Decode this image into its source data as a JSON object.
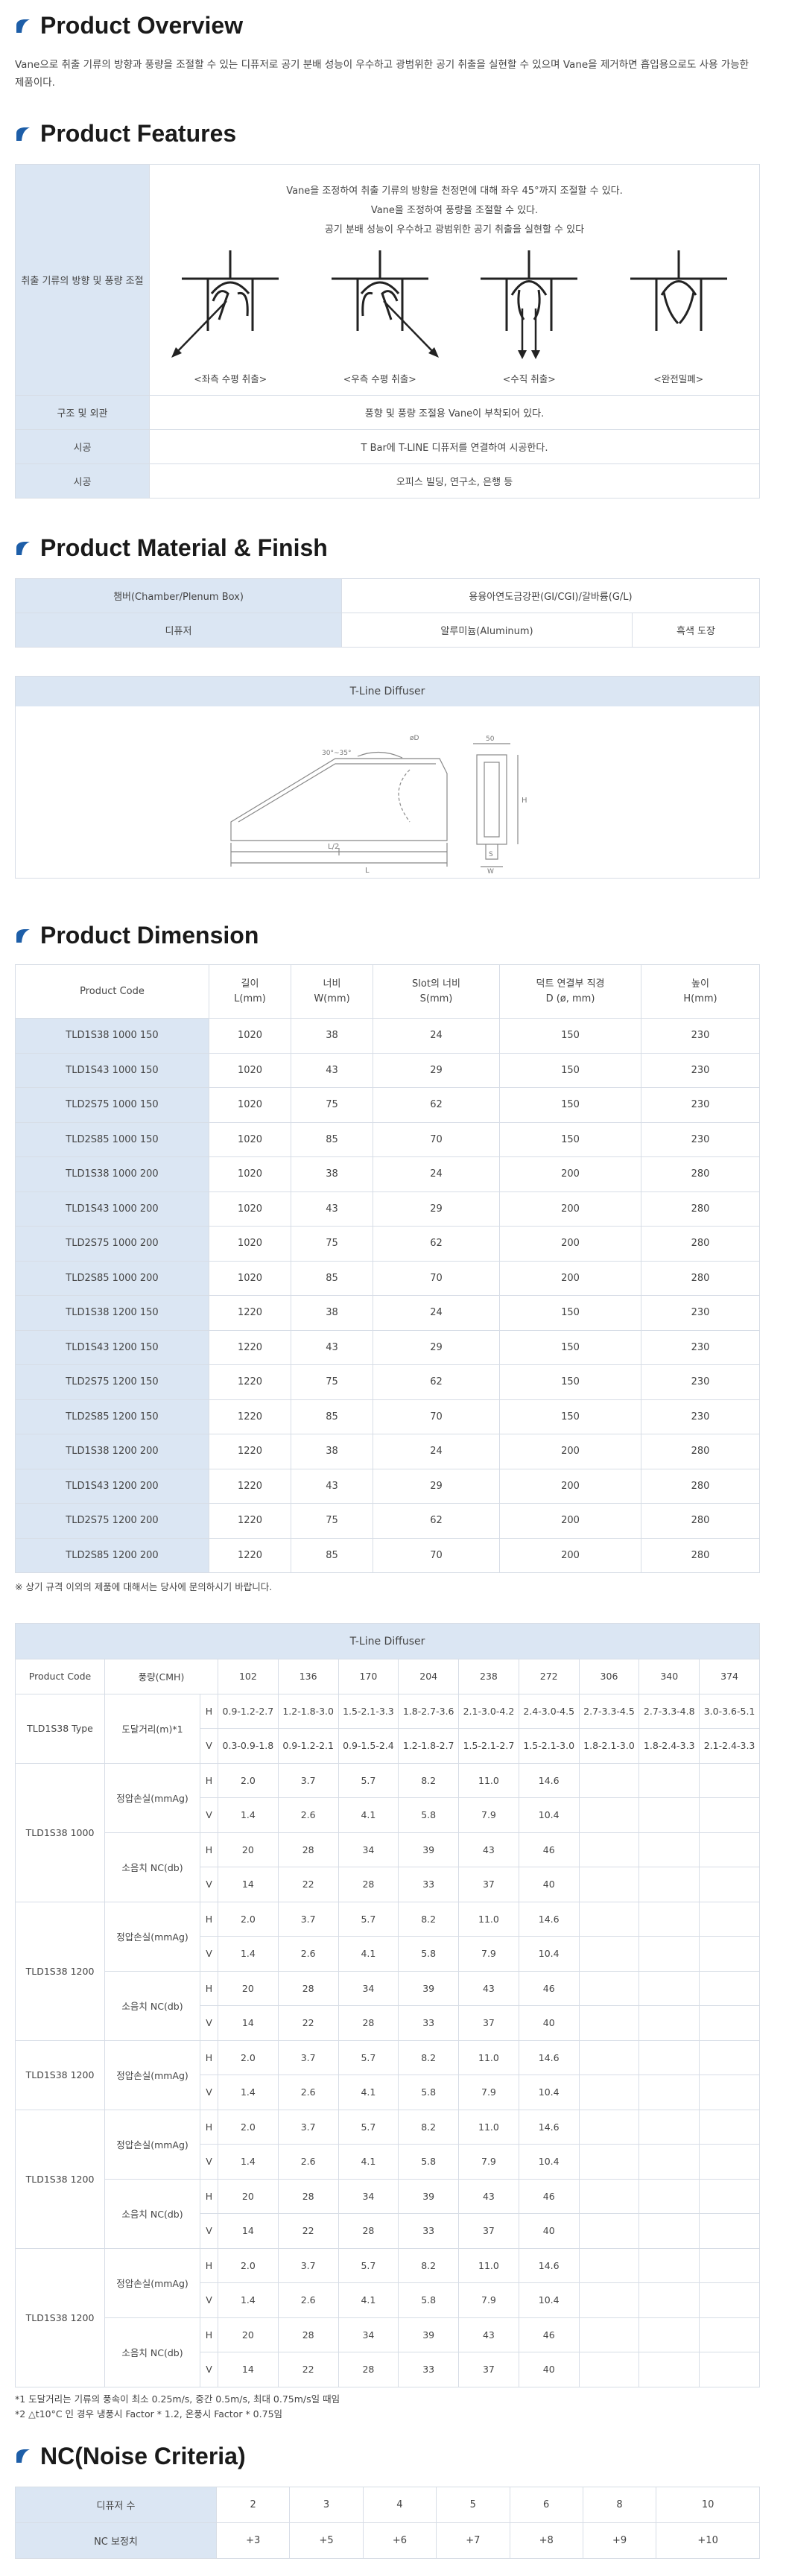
{
  "overview": {
    "title": "Product Overview",
    "text": "Vane으로 취출 기류의 방향과 풍량을 조절할 수 있는 디퓨저로 공기 분배 성능이 우수하고 광범위한 공기 취출을 실현할 수 있으며 Vane을 제거하면 흡입용으로도 사용 가능한 제품이다."
  },
  "features": {
    "title": "Product Features",
    "row1_label": "취출 기류의 방향 및 풍량 조절",
    "lines": [
      "Vane을 조정하여 취출 기류의 방향을 천정면에 대해 좌우 45°까지 조절할 수 있다.",
      "Vane을 조정하여 풍량을 조절할 수 있다.",
      "공기 분배 성능이 우수하고 광범위한 공기 취출을 실현할 수 있다"
    ],
    "captions": [
      "<좌측 수평 취출>",
      "<우측 수평 취출>",
      "<수직 취출>",
      "<완전밀폐>"
    ],
    "rows": [
      {
        "label": "구조 및 외관",
        "value": "풍향 및 풍량 조절용 Vane이 부착되어 있다."
      },
      {
        "label": "시공",
        "value": "T Bar에 T-LINE 디퓨저를 연결하여 시공한다."
      },
      {
        "label": "시공",
        "value": "오피스 빌딩, 연구소, 은행 등"
      }
    ]
  },
  "material": {
    "title": "Product Material & Finish",
    "rows": [
      {
        "label": "챔버(Chamber/Plenum Box)",
        "value": "용융아연도금강판(GI/CGI)/갈바륨(G/L)",
        "finish": ""
      },
      {
        "label": "디퓨저",
        "value": "알루미늄(Aluminum)",
        "finish": "흑색 도장"
      }
    ],
    "diagram_title": "T-Line Diffuser",
    "diagram_labels": {
      "angle": "30°~35°",
      "dia": "øD",
      "l2": "L/2",
      "l": "L",
      "h": "H",
      "s": "S",
      "w": "W",
      "top": "50"
    }
  },
  "dimension": {
    "title": "Product Dimension",
    "headers": [
      "Product Code",
      "길이\nL(mm)",
      "너비\nW(mm)",
      "Slot의 너비\nS(mm)",
      "덕트 연결부 직경\nD (ø, mm)",
      "높이\nH(mm)"
    ],
    "rows": [
      [
        "TLD1S38 1000 150",
        "1020",
        "38",
        "24",
        "150",
        "230"
      ],
      [
        "TLD1S43 1000 150",
        "1020",
        "43",
        "29",
        "150",
        "230"
      ],
      [
        "TLD2S75 1000 150",
        "1020",
        "75",
        "62",
        "150",
        "230"
      ],
      [
        "TLD2S85 1000 150",
        "1020",
        "85",
        "70",
        "150",
        "230"
      ],
      [
        "TLD1S38 1000 200",
        "1020",
        "38",
        "24",
        "200",
        "280"
      ],
      [
        "TLD1S43 1000 200",
        "1020",
        "43",
        "29",
        "200",
        "280"
      ],
      [
        "TLD2S75 1000 200",
        "1020",
        "75",
        "62",
        "200",
        "280"
      ],
      [
        "TLD2S85 1000 200",
        "1020",
        "85",
        "70",
        "200",
        "280"
      ],
      [
        "TLD1S38 1200 150",
        "1220",
        "38",
        "24",
        "150",
        "230"
      ],
      [
        "TLD1S43 1200 150",
        "1220",
        "43",
        "29",
        "150",
        "230"
      ],
      [
        "TLD2S75 1200 150",
        "1220",
        "75",
        "62",
        "150",
        "230"
      ],
      [
        "TLD2S85 1200 150",
        "1220",
        "85",
        "70",
        "150",
        "230"
      ],
      [
        "TLD1S38 1200 200",
        "1220",
        "38",
        "24",
        "200",
        "280"
      ],
      [
        "TLD1S43 1200 200",
        "1220",
        "43",
        "29",
        "200",
        "280"
      ],
      [
        "TLD2S75 1200 200",
        "1220",
        "75",
        "62",
        "200",
        "280"
      ],
      [
        "TLD2S85 1200 200",
        "1220",
        "85",
        "70",
        "200",
        "280"
      ]
    ],
    "note": "※ 상기 규격 이외의 제품에 대해서는 당사에 문의하시기 바랍니다."
  },
  "performance": {
    "title": "T-Line Diffuser",
    "code_label": "Product Code",
    "flow_label": "풍량(CMH)",
    "flows": [
      "102",
      "136",
      "170",
      "204",
      "238",
      "272",
      "306",
      "340",
      "374"
    ],
    "type_label": "TLD1S38 Type",
    "throw_label": "도달거리(m)*1",
    "throw_h": [
      "0.9-1.2-2.7",
      "1.2-1.8-3.0",
      "1.5-2.1-3.3",
      "1.8-2.7-3.6",
      "2.1-3.0-4.2",
      "2.4-3.0-4.5",
      "2.7-3.3-4.5",
      "2.7-3.3-4.8",
      "3.0-3.6-5.1"
    ],
    "throw_v": [
      "0.3-0.9-1.8",
      "0.9-1.2-2.1",
      "0.9-1.5-2.4",
      "1.2-1.8-2.7",
      "1.5-2.1-2.7",
      "1.5-2.1-3.0",
      "1.8-2.1-3.0",
      "1.8-2.4-3.3",
      "2.1-2.4-3.3"
    ],
    "sp_label": "정압손실(mmAg)",
    "nc_label": "소음치 NC(db)",
    "groups": [
      {
        "code": "TLD1S38 1000",
        "sp_h": [
          "2.0",
          "3.7",
          "5.7",
          "8.2",
          "11.0",
          "14.6"
        ],
        "sp_v": [
          "1.4",
          "2.6",
          "4.1",
          "5.8",
          "7.9",
          "10.4"
        ],
        "nc_h": [
          "20",
          "28",
          "34",
          "39",
          "43",
          "46"
        ],
        "nc_v": [
          "14",
          "22",
          "28",
          "33",
          "37",
          "40"
        ]
      },
      {
        "code": "TLD1S38 1200",
        "sp_h": [
          "2.0",
          "3.7",
          "5.7",
          "8.2",
          "11.0",
          "14.6"
        ],
        "sp_v": [
          "1.4",
          "2.6",
          "4.1",
          "5.8",
          "7.9",
          "10.4"
        ],
        "nc_h": [
          "20",
          "28",
          "34",
          "39",
          "43",
          "46"
        ],
        "nc_v": [
          "14",
          "22",
          "28",
          "33",
          "37",
          "40"
        ]
      }
    ],
    "mid_group": {
      "code": "TLD1S38 1200",
      "sp_h": [
        "2.0",
        "3.7",
        "5.7",
        "8.2",
        "11.0",
        "14.6"
      ],
      "sp_v": [
        "1.4",
        "2.6",
        "4.1",
        "5.8",
        "7.9",
        "10.4"
      ]
    },
    "tail_groups": [
      {
        "code": "TLD1S38 1200",
        "sp_h": [
          "2.0",
          "3.7",
          "5.7",
          "8.2",
          "11.0",
          "14.6"
        ],
        "sp_v": [
          "1.4",
          "2.6",
          "4.1",
          "5.8",
          "7.9",
          "10.4"
        ],
        "nc_h": [
          "20",
          "28",
          "34",
          "39",
          "43",
          "46"
        ],
        "nc_v": [
          "14",
          "22",
          "28",
          "33",
          "37",
          "40"
        ]
      },
      {
        "code": "TLD1S38 1200",
        "sp_h": [
          "2.0",
          "3.7",
          "5.7",
          "8.2",
          "11.0",
          "14.6"
        ],
        "sp_v": [
          "1.4",
          "2.6",
          "4.1",
          "5.8",
          "7.9",
          "10.4"
        ],
        "nc_h": [
          "20",
          "28",
          "34",
          "39",
          "43",
          "46"
        ],
        "nc_v": [
          "14",
          "22",
          "28",
          "33",
          "37",
          "40"
        ]
      }
    ],
    "notes": [
      "*1 도달거리는 기류의 풍속이 최소 0.25m/s, 중간 0.5m/s, 최대 0.75m/s일 때임",
      "*2 △t10°C 인 경우 냉풍시 Factor * 1.2, 온풍시 Factor * 0.75임"
    ]
  },
  "nc": {
    "title": "NC(Noise Criteria)",
    "row1_label": "디퓨저 수",
    "row1": [
      "2",
      "3",
      "4",
      "5",
      "6",
      "8",
      "10"
    ],
    "row2_label": "NC 보정치",
    "row2": [
      "+3",
      "+5",
      "+6",
      "+7",
      "+8",
      "+9",
      "+10"
    ]
  }
}
